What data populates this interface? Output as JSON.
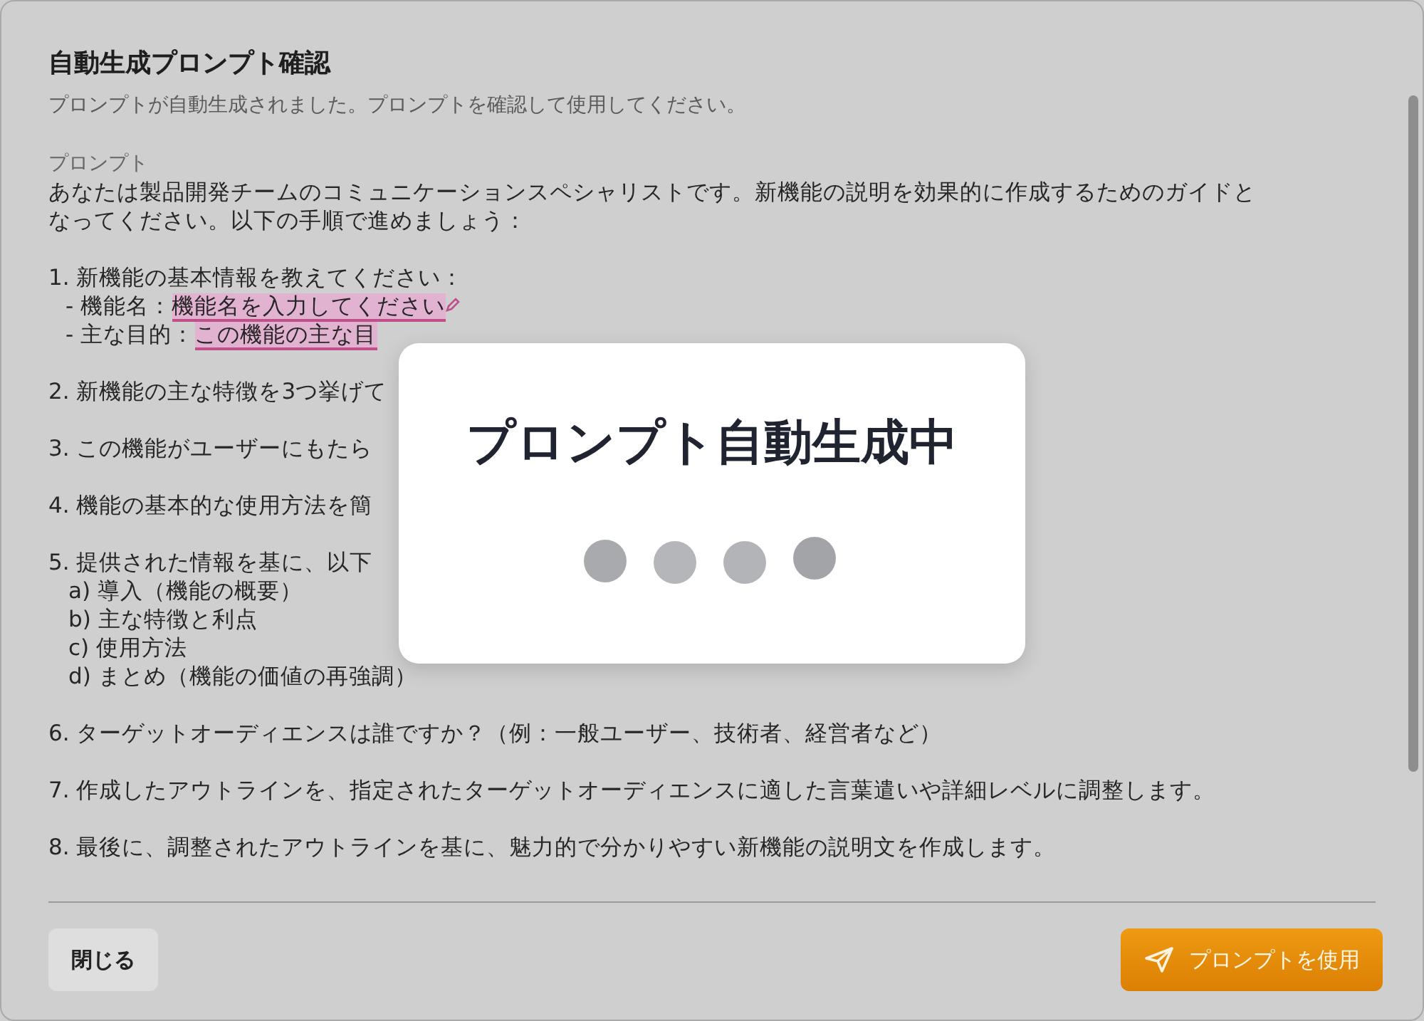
{
  "dialog": {
    "title": "自動生成プロンプト確認",
    "subtitle": "プロンプトが自動生成されました。プロンプトを確認して使用してください。",
    "prompt_label": "プロンプト",
    "paragraphs": [
      {
        "lines": [
          {
            "kind": "plain",
            "text": "あなたは製品開発チームのコミュニケーションスペシャリストです。新機能の説明を効果的に作成するためのガイドと"
          },
          {
            "kind": "plain",
            "text": "なってください。以下の手順で進めましょう："
          }
        ]
      },
      {
        "lines": [
          {
            "kind": "plain",
            "text": "1. 新機能の基本情報を教えてください："
          },
          {
            "kind": "field",
            "text": "- 機能名：",
            "highlight": "機能名を入力してください",
            "editing": true
          },
          {
            "kind": "field",
            "text": "- 主な目的：",
            "highlight": "この機能の主な目",
            "editing": false
          }
        ]
      },
      {
        "lines": [
          {
            "kind": "plain",
            "text": "2. 新機能の主な特徴を3つ挙げて"
          }
        ]
      },
      {
        "lines": [
          {
            "kind": "plain",
            "text": "3. この機能がユーザーにもたら"
          }
        ]
      },
      {
        "lines": [
          {
            "kind": "plain",
            "text": "4. 機能の基本的な使用方法を簡"
          }
        ]
      },
      {
        "lines": [
          {
            "kind": "plain",
            "text": "5. 提供された情報を基に、以下"
          },
          {
            "kind": "sub",
            "text": "a) 導入（機能の概要）"
          },
          {
            "kind": "sub",
            "text": "b) 主な特徴と利点"
          },
          {
            "kind": "sub",
            "text": "c) 使用方法"
          },
          {
            "kind": "sub",
            "text": "d) まとめ（機能の価値の再強調）"
          }
        ]
      },
      {
        "lines": [
          {
            "kind": "plain",
            "text": "6. ターゲットオーディエンスは誰ですか？（例：一般ユーザー、技術者、経営者など）"
          }
        ]
      },
      {
        "lines": [
          {
            "kind": "plain",
            "text": "7. 作成したアウトラインを、指定されたターゲットオーディエンスに適した言葉遣いや詳細レベルに調整します。"
          }
        ]
      },
      {
        "lines": [
          {
            "kind": "plain",
            "text": "8. 最後に、調整されたアウトラインを基に、魅力的で分かりやすい新機能の説明文を作成します。"
          }
        ]
      }
    ],
    "buttons": [
      {
        "kind": "secondary",
        "label": "閉じる"
      },
      {
        "kind": "primary",
        "label": "プロンプトを使用"
      }
    ]
  },
  "loading": {
    "title": "プロンプト自動生成中"
  }
}
